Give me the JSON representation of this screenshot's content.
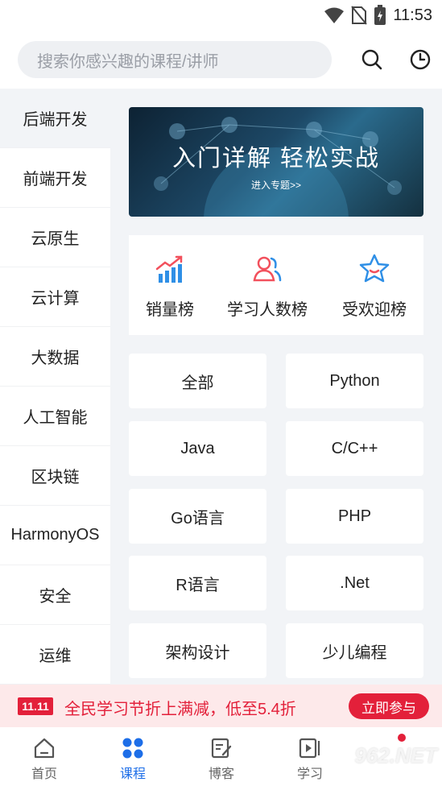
{
  "status_bar": {
    "time": "11:53"
  },
  "search": {
    "placeholder": "搜索你感兴趣的课程/讲师"
  },
  "sidebar": {
    "items": [
      {
        "label": "后端开发",
        "active": true
      },
      {
        "label": "前端开发"
      },
      {
        "label": "云原生"
      },
      {
        "label": "云计算"
      },
      {
        "label": "大数据"
      },
      {
        "label": "人工智能"
      },
      {
        "label": "区块链"
      },
      {
        "label": "HarmonyOS"
      },
      {
        "label": "安全"
      },
      {
        "label": "运维"
      }
    ]
  },
  "banner": {
    "title": "入门详解   轻松实战",
    "subtitle": "进入专题>>"
  },
  "rankings": [
    {
      "label": "销量榜",
      "icon": "bar-chart-icon"
    },
    {
      "label": "学习人数榜",
      "icon": "users-icon"
    },
    {
      "label": "受欢迎榜",
      "icon": "star-icon"
    }
  ],
  "categories": [
    "全部",
    "Python",
    "Java",
    "C/C++",
    "Go语言",
    "PHP",
    "R语言",
    ".Net",
    "架构设计",
    "少儿编程"
  ],
  "promo": {
    "badge": "11.11",
    "text": "全民学习节折上满减，低至5.4折",
    "button": "立即参与"
  },
  "bottom_nav": [
    {
      "label": "首页",
      "icon": "home-icon"
    },
    {
      "label": "课程",
      "icon": "grid-icon",
      "active": true
    },
    {
      "label": "博客",
      "icon": "edit-doc-icon"
    },
    {
      "label": "学习",
      "icon": "play-icon"
    }
  ],
  "watermark": "962.NET",
  "colors": {
    "accent": "#1d6ee8",
    "promo_red": "#e3203a",
    "bg_gray": "#f2f4f7"
  }
}
